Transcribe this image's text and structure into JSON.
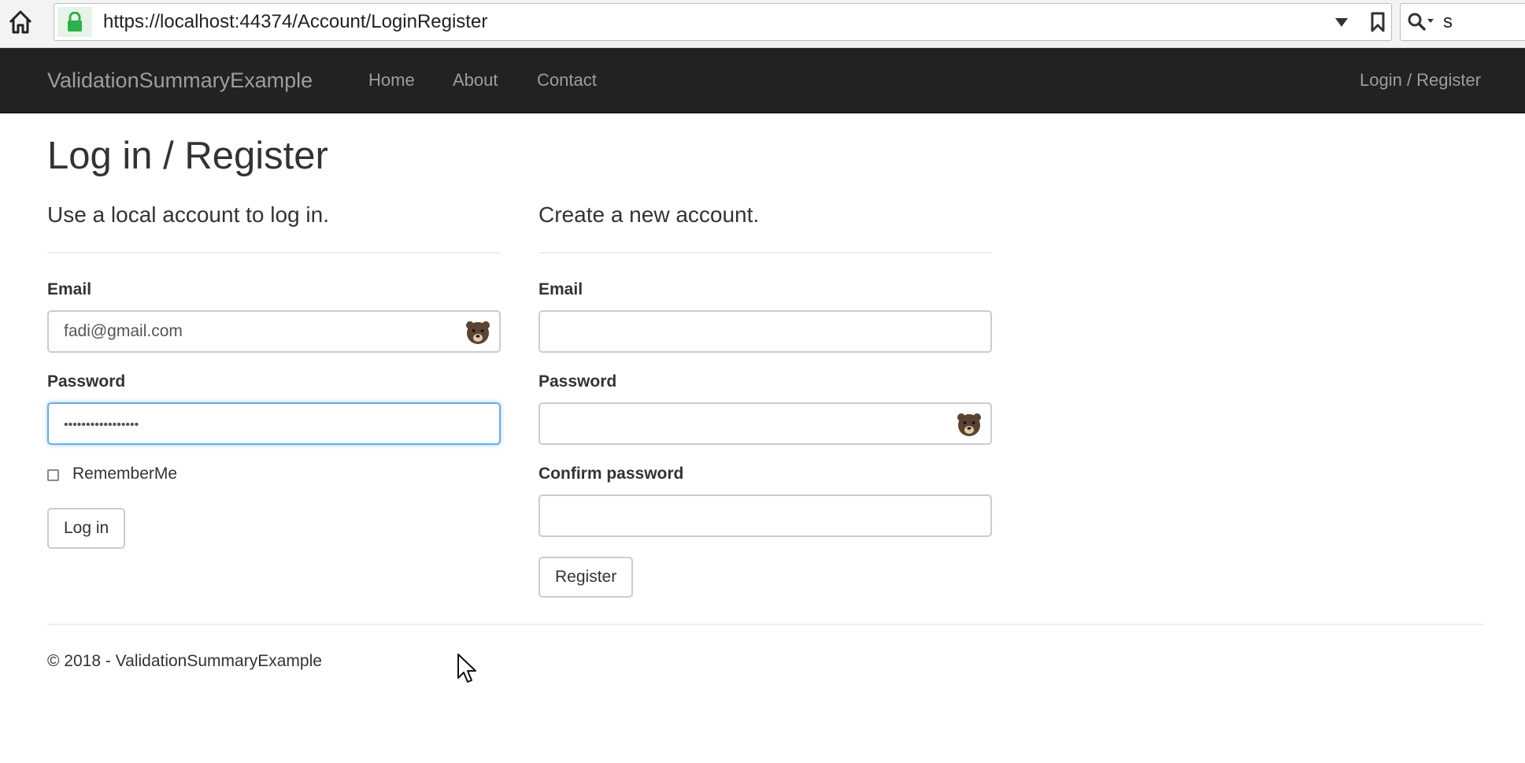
{
  "browser": {
    "url": "https://localhost:44374/Account/LoginRegister",
    "search_text": "s"
  },
  "navbar": {
    "brand": "ValidationSummaryExample",
    "links": [
      "Home",
      "About",
      "Contact"
    ],
    "login_register": "Login / Register"
  },
  "page": {
    "title": "Log in / Register"
  },
  "login": {
    "heading": "Use a local account to log in.",
    "email_label": "Email",
    "email_value": "fadi@gmail.com",
    "password_label": "Password",
    "password_value": "•••••••••••••••••",
    "remember_label": "RememberMe",
    "submit_label": "Log in"
  },
  "register": {
    "heading": "Create a new account.",
    "email_label": "Email",
    "email_value": "",
    "password_label": "Password",
    "password_value": "",
    "confirm_label": "Confirm password",
    "confirm_value": "",
    "submit_label": "Register"
  },
  "footer": {
    "text": "© 2018 - ValidationSummaryExample"
  },
  "colors": {
    "navbar_bg": "#222222",
    "nav_text": "#9d9d9d",
    "focus_border": "#66afe9",
    "lock_green": "#2bb24c"
  }
}
